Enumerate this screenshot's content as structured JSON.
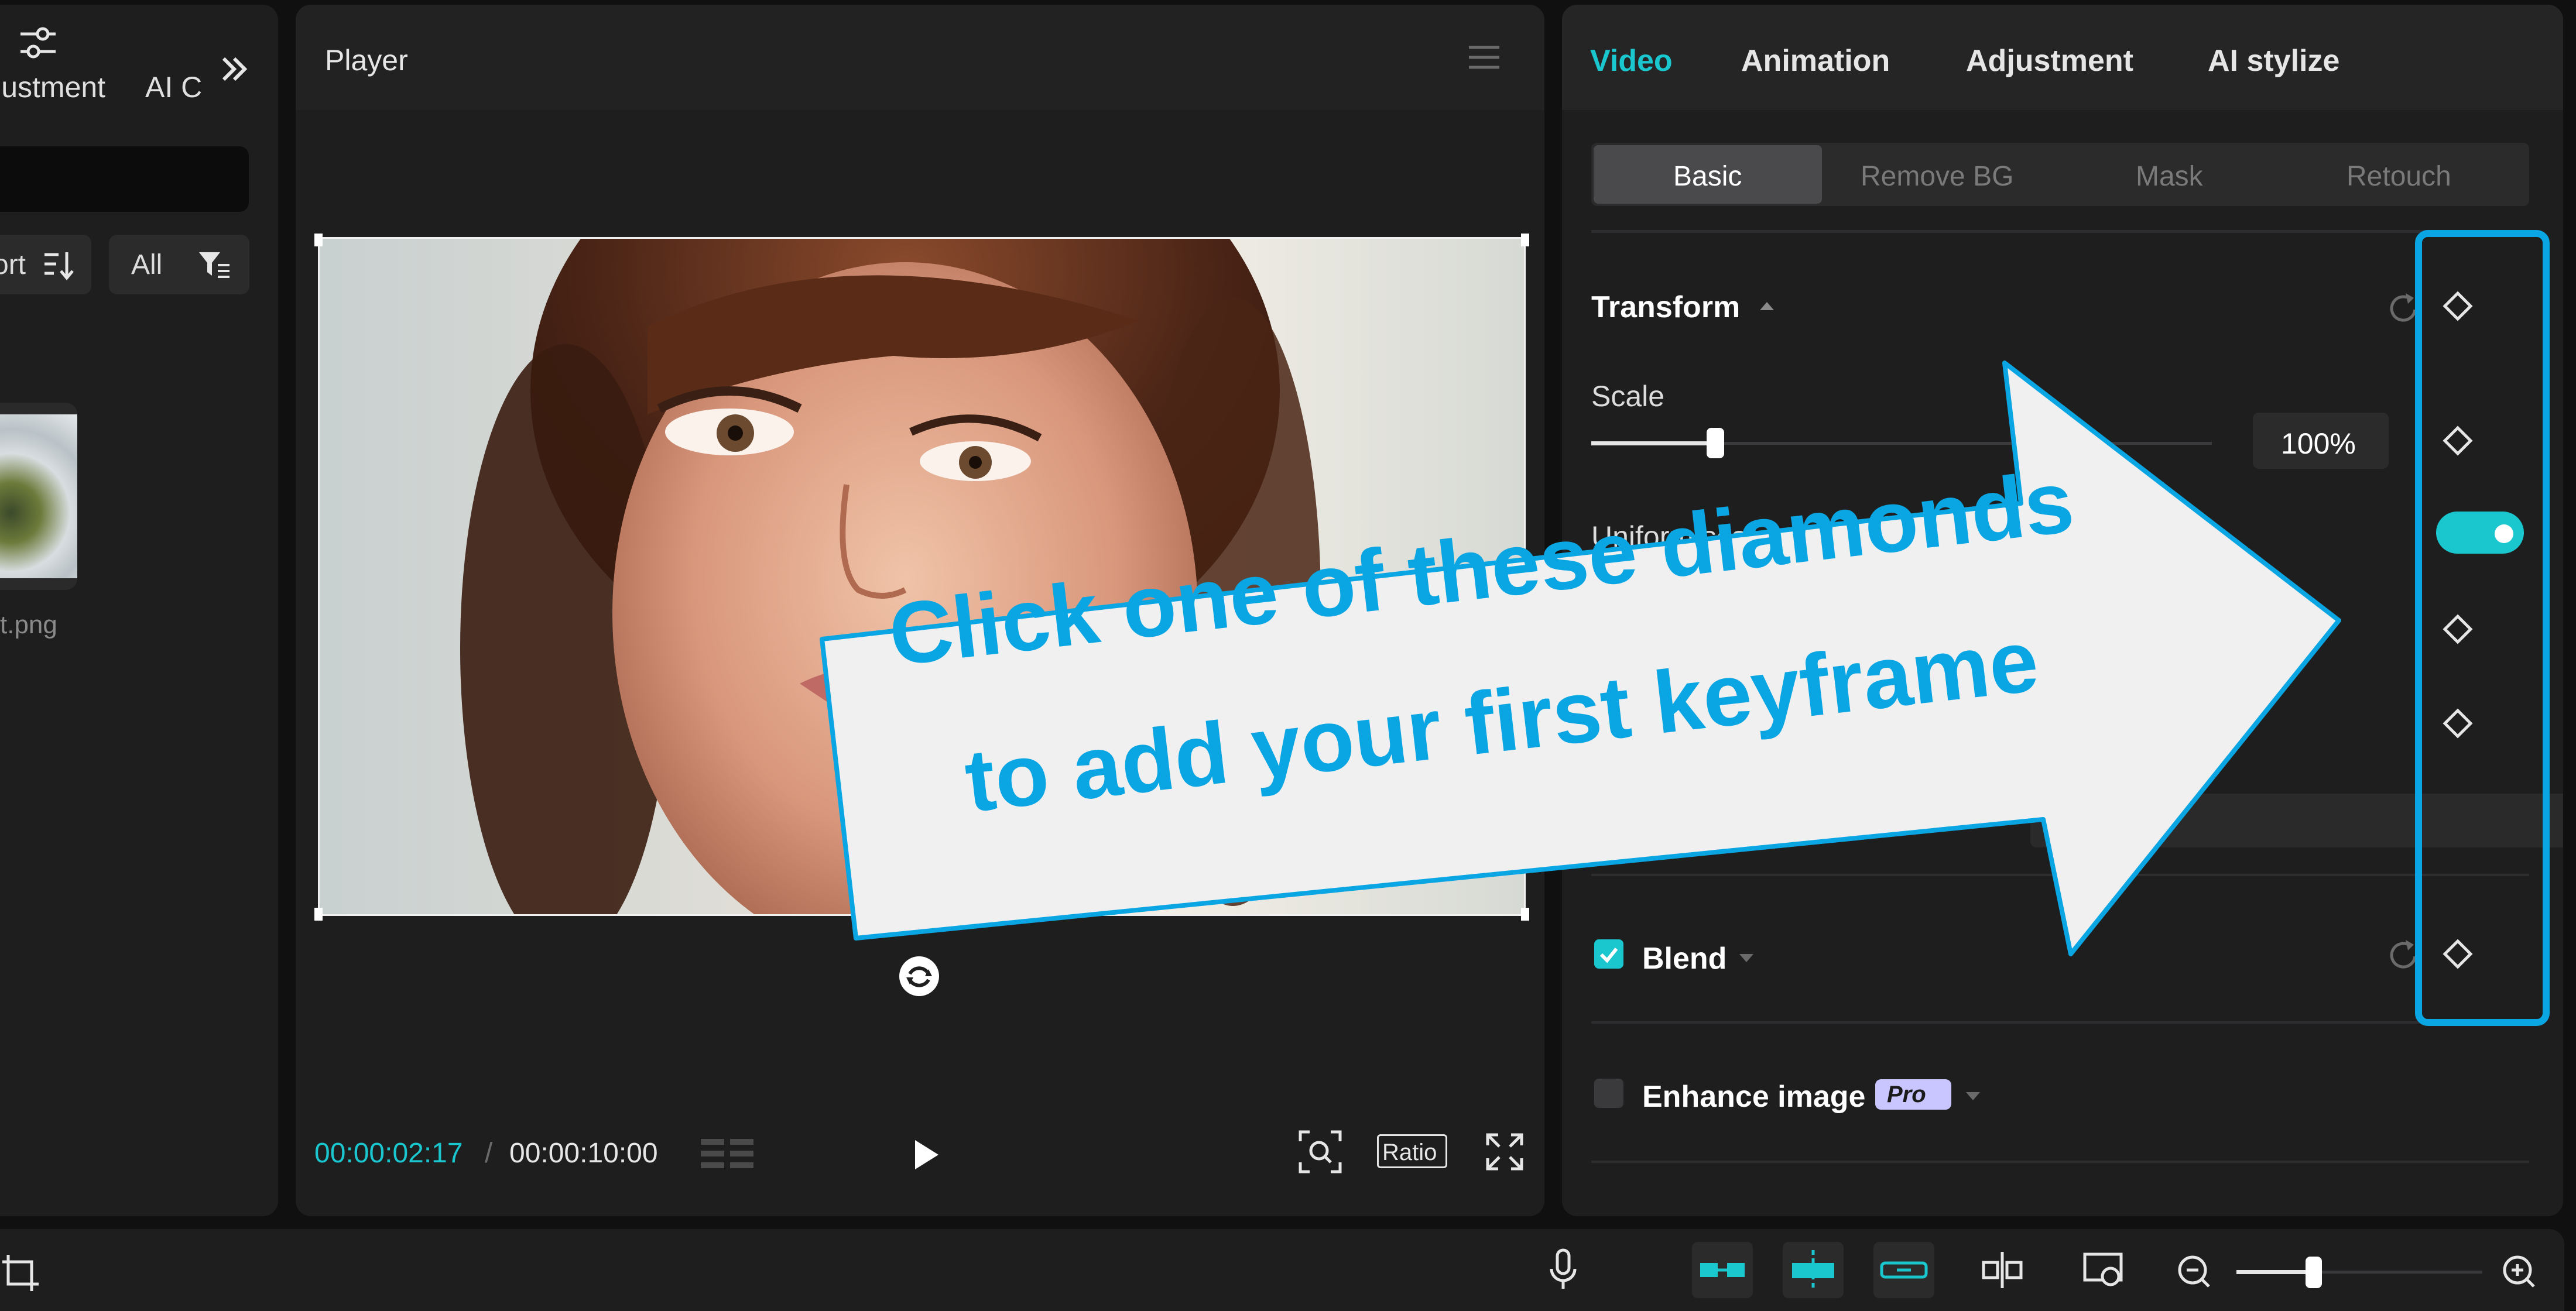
{
  "left_panel": {
    "tabs": [
      "ljustment",
      "AI C"
    ],
    "sort_label": "ort",
    "filter_label": "All",
    "file_name": "t.png"
  },
  "player": {
    "title": "Player",
    "time_current": "00:00:02:17",
    "time_separator": "/",
    "time_total": "00:00:10:00",
    "ratio_label": "Ratio"
  },
  "inspector": {
    "tabs": [
      {
        "label": "Video",
        "active": true
      },
      {
        "label": "Animation",
        "active": false
      },
      {
        "label": "Adjustment",
        "active": false
      },
      {
        "label": "AI stylize",
        "active": false
      }
    ],
    "subtabs": [
      {
        "label": "Basic",
        "active": true
      },
      {
        "label": "Remove BG",
        "active": false
      },
      {
        "label": "Mask",
        "active": false
      },
      {
        "label": "Retouch",
        "active": false
      }
    ],
    "transform_label": "Transform",
    "scale_label": "Scale",
    "scale_value": "100%",
    "scale_fraction": 0.2,
    "uniform_scale_label": "Uniform scale",
    "uniform_scale_on": true,
    "blend_label": "Blend",
    "blend_checked": true,
    "enhance_label": "Enhance image",
    "enhance_badge": "Pro",
    "enhance_checked": false
  },
  "callout": {
    "line1": "Click one of these diamonds",
    "line2": "to add your first keyframe"
  },
  "colors": {
    "accent": "#1ac7cf",
    "callout_blue": "#0aa6e3",
    "callout_fill": "#f0f0f0",
    "panel_bg": "#1e1e1f"
  }
}
